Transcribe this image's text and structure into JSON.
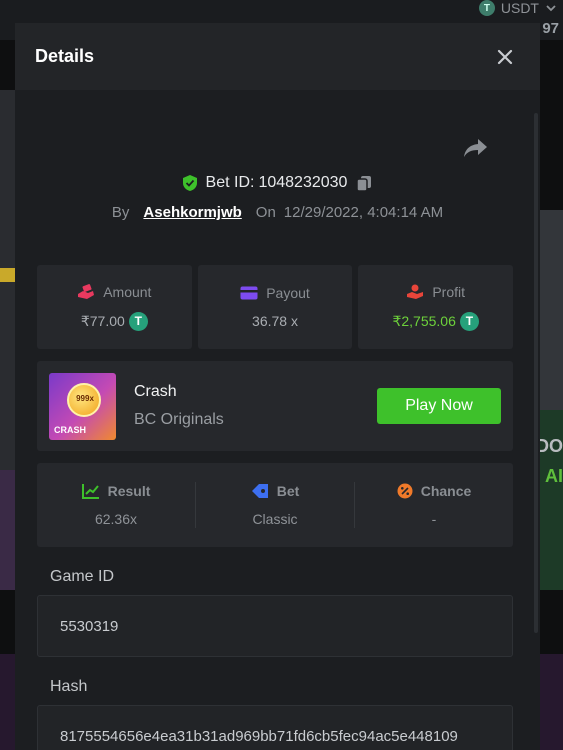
{
  "background": {
    "currency": "USDT",
    "balance_fragment": "97",
    "right_text_top": "DO",
    "right_text_green": "AI"
  },
  "modal": {
    "title": "Details",
    "bet_id_label": "Bet ID:",
    "bet_id": "1048232030",
    "by_label": "By",
    "username": "Asehkormjwb",
    "on_label": "On",
    "datetime": "12/29/2022, 4:04:14 AM"
  },
  "stats": {
    "amount_label": "Amount",
    "amount_value": "₹77.00",
    "payout_label": "Payout",
    "payout_value": "36.78 x",
    "profit_label": "Profit",
    "profit_value": "₹2,755.06"
  },
  "game": {
    "name": "Crash",
    "provider": "BC Originals",
    "thumb_label": "CRASH",
    "thumb_multiplier": "999x",
    "play_button": "Play Now"
  },
  "result": {
    "result_label": "Result",
    "result_value": "62.36x",
    "bet_label": "Bet",
    "bet_value": "Classic",
    "chance_label": "Chance",
    "chance_value": "-"
  },
  "fields": {
    "game_id_label": "Game ID",
    "game_id_value": "5530319",
    "hash_label": "Hash",
    "hash_value": "8175554656e4ea31b31ad969bb71fd6cb5fec94ac5e448109"
  },
  "colors": {
    "accent_green": "#3ec12b",
    "profit_green": "#6dd13b",
    "tether": "#26a17b"
  }
}
